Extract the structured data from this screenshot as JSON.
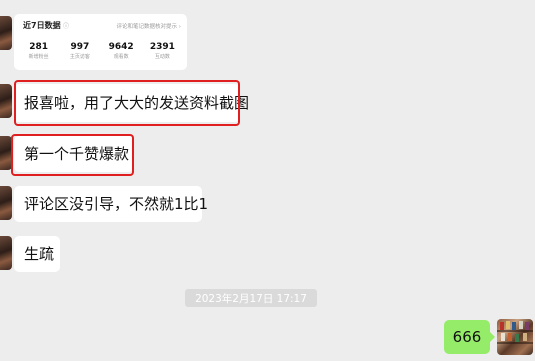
{
  "stats_card": {
    "title": "近7日数据",
    "help_icon": "help-circle-icon",
    "link": "评论和笔记数据核对提示 ›",
    "metrics": [
      {
        "value": "281",
        "label": "新增粉丝"
      },
      {
        "value": "997",
        "label": "主页访客"
      },
      {
        "value": "9642",
        "label": "观看数"
      },
      {
        "value": "2391",
        "label": "互动数"
      }
    ]
  },
  "messages": [
    {
      "text": "报喜啦，用了大大的发送资料截图",
      "highlighted": true
    },
    {
      "text": "第一个千赞爆款",
      "highlighted": true
    },
    {
      "text": "评论区没引导，不然就1比1",
      "highlighted": false
    },
    {
      "text": "生疏",
      "highlighted": false
    }
  ],
  "timestamp": "2023年2月17日 17:17",
  "my_message": {
    "text": "666"
  },
  "colors": {
    "background": "#ededed",
    "my_bubble": "#95ec69",
    "highlight": "#e02020"
  }
}
